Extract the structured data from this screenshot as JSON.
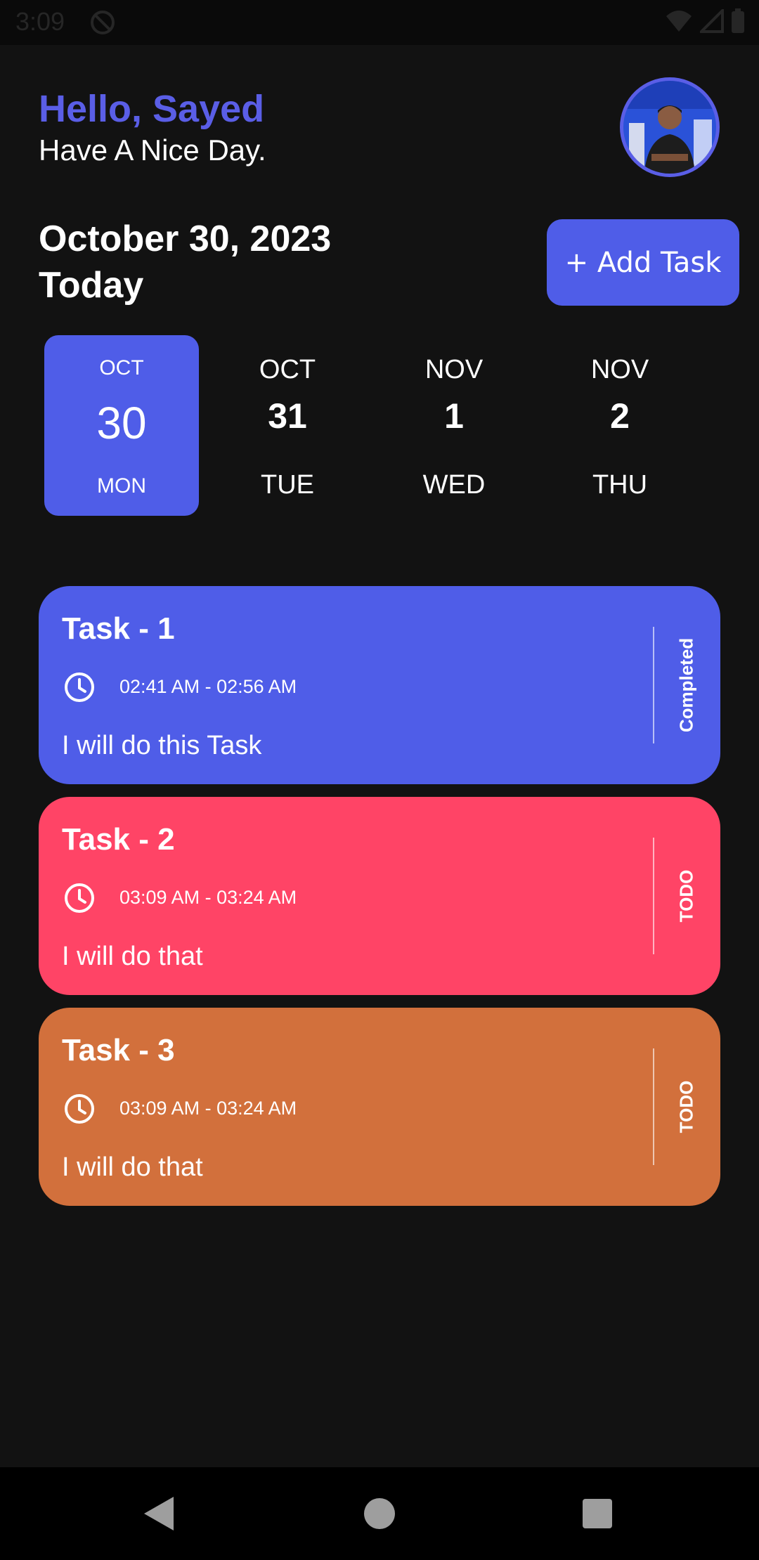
{
  "status_bar": {
    "time": "3:09"
  },
  "header": {
    "greeting": "Hello, Sayed",
    "subtitle": "Have A Nice Day."
  },
  "date_section": {
    "date": "October 30, 2023",
    "today": "Today",
    "add_task_label": "+ Add Task"
  },
  "calendar": {
    "days": [
      {
        "month": "OCT",
        "day": "30",
        "weekday": "MON",
        "selected": true
      },
      {
        "month": "OCT",
        "day": "31",
        "weekday": "TUE",
        "selected": false
      },
      {
        "month": "NOV",
        "day": "1",
        "weekday": "WED",
        "selected": false
      },
      {
        "month": "NOV",
        "day": "2",
        "weekday": "THU",
        "selected": false
      }
    ]
  },
  "tasks": [
    {
      "title": "Task - 1",
      "time": "02:41 AM - 02:56 AM",
      "note": "I will do this Task",
      "status": "Completed",
      "color": "#4f5de8"
    },
    {
      "title": "Task - 2",
      "time": "03:09 AM - 03:24 AM",
      "note": "I will do that",
      "status": "TODO",
      "color": "#ff4466"
    },
    {
      "title": "Task - 3",
      "time": "03:09 AM - 03:24 AM",
      "note": "I will do that",
      "status": "TODO",
      "color": "#d2703c"
    }
  ],
  "colors": {
    "accent": "#4f5de8",
    "background": "#121212"
  },
  "icons": {
    "clock": "clock-icon",
    "back": "back-icon",
    "home": "home-icon",
    "recents": "recents-icon"
  }
}
